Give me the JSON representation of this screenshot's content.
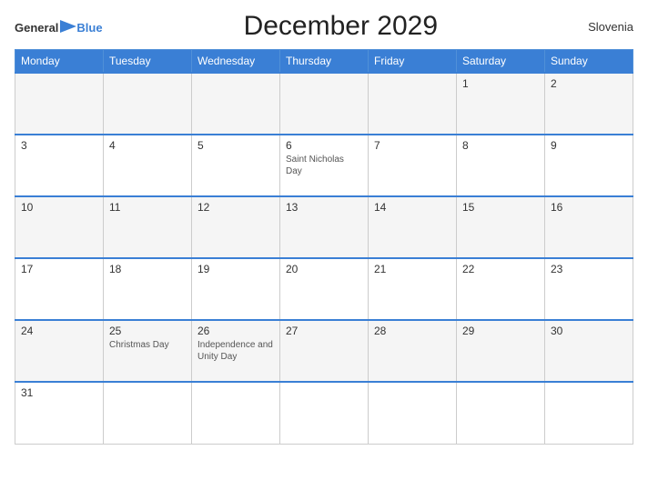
{
  "header": {
    "logo_general": "General",
    "logo_blue": "Blue",
    "title": "December 2029",
    "country": "Slovenia"
  },
  "calendar": {
    "days_of_week": [
      "Monday",
      "Tuesday",
      "Wednesday",
      "Thursday",
      "Friday",
      "Saturday",
      "Sunday"
    ],
    "weeks": [
      [
        {
          "day": "",
          "holiday": ""
        },
        {
          "day": "",
          "holiday": ""
        },
        {
          "day": "",
          "holiday": ""
        },
        {
          "day": "",
          "holiday": ""
        },
        {
          "day": "",
          "holiday": ""
        },
        {
          "day": "1",
          "holiday": ""
        },
        {
          "day": "2",
          "holiday": ""
        }
      ],
      [
        {
          "day": "3",
          "holiday": ""
        },
        {
          "day": "4",
          "holiday": ""
        },
        {
          "day": "5",
          "holiday": ""
        },
        {
          "day": "6",
          "holiday": "Saint Nicholas Day"
        },
        {
          "day": "7",
          "holiday": ""
        },
        {
          "day": "8",
          "holiday": ""
        },
        {
          "day": "9",
          "holiday": ""
        }
      ],
      [
        {
          "day": "10",
          "holiday": ""
        },
        {
          "day": "11",
          "holiday": ""
        },
        {
          "day": "12",
          "holiday": ""
        },
        {
          "day": "13",
          "holiday": ""
        },
        {
          "day": "14",
          "holiday": ""
        },
        {
          "day": "15",
          "holiday": ""
        },
        {
          "day": "16",
          "holiday": ""
        }
      ],
      [
        {
          "day": "17",
          "holiday": ""
        },
        {
          "day": "18",
          "holiday": ""
        },
        {
          "day": "19",
          "holiday": ""
        },
        {
          "day": "20",
          "holiday": ""
        },
        {
          "day": "21",
          "holiday": ""
        },
        {
          "day": "22",
          "holiday": ""
        },
        {
          "day": "23",
          "holiday": ""
        }
      ],
      [
        {
          "day": "24",
          "holiday": ""
        },
        {
          "day": "25",
          "holiday": "Christmas Day"
        },
        {
          "day": "26",
          "holiday": "Independence and Unity Day"
        },
        {
          "day": "27",
          "holiday": ""
        },
        {
          "day": "28",
          "holiday": ""
        },
        {
          "day": "29",
          "holiday": ""
        },
        {
          "day": "30",
          "holiday": ""
        }
      ],
      [
        {
          "day": "31",
          "holiday": ""
        },
        {
          "day": "",
          "holiday": ""
        },
        {
          "day": "",
          "holiday": ""
        },
        {
          "day": "",
          "holiday": ""
        },
        {
          "day": "",
          "holiday": ""
        },
        {
          "day": "",
          "holiday": ""
        },
        {
          "day": "",
          "holiday": ""
        }
      ]
    ]
  }
}
